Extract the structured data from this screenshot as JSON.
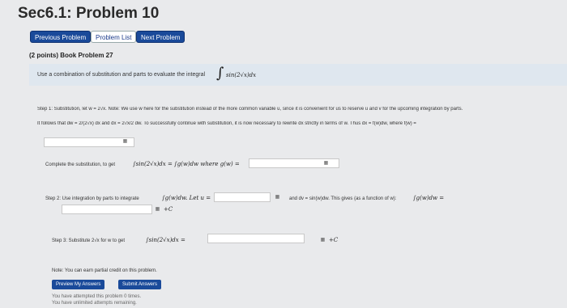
{
  "page": {
    "title": "Sec6.1: Problem 10"
  },
  "nav": {
    "prev": "Previous Problem",
    "list": "Problem List",
    "next": "Next Problem"
  },
  "problem": {
    "points": "(2 points) Book Problem 27",
    "prompt_text": "Use a combination of substitution and parts to evaluate the integral",
    "integral": "sin(2√x)dx"
  },
  "step1": {
    "text": "Step 1: Substitution, let w = 2√x. Note: We use w here for the substitution instead of the more common variable u, since it is convenient for us to reserve u and v for the upcoming integration by parts.",
    "follows": "It follows that dw = 2/(2√x) dx and dx = 2√x/2 dw. To successfully continue with substitution, it is now necessary to rewrite dx strictly in terms of w. Thus dx = f(w)dw, where f(w) ="
  },
  "complete": {
    "text": "Complete the substitution, to get",
    "eq": "∫sin(2√x)dx = ∫g(w)dw where g(w) ="
  },
  "step2": {
    "text": "Step 2: Use integration by parts to integrate",
    "intg": "∫g(w)dw. Let u =",
    "and": "and dv = sin(w)dw. This gives (as a function of w):",
    "res": "∫g(w)dw =",
    "plusc": "+C"
  },
  "step3": {
    "text": "Step 3: Substitute 2√x for w to get",
    "int": "∫sin(2√x)dx =",
    "plusc": "+C"
  },
  "note": "Note: You can earn partial credit on this problem.",
  "buttons": {
    "preview": "Preview My Answers",
    "submit": "Submit Answers"
  },
  "footer": {
    "attempted": "You have attempted this problem 0 times.",
    "unlimited": "You have unlimited attempts remaining."
  }
}
